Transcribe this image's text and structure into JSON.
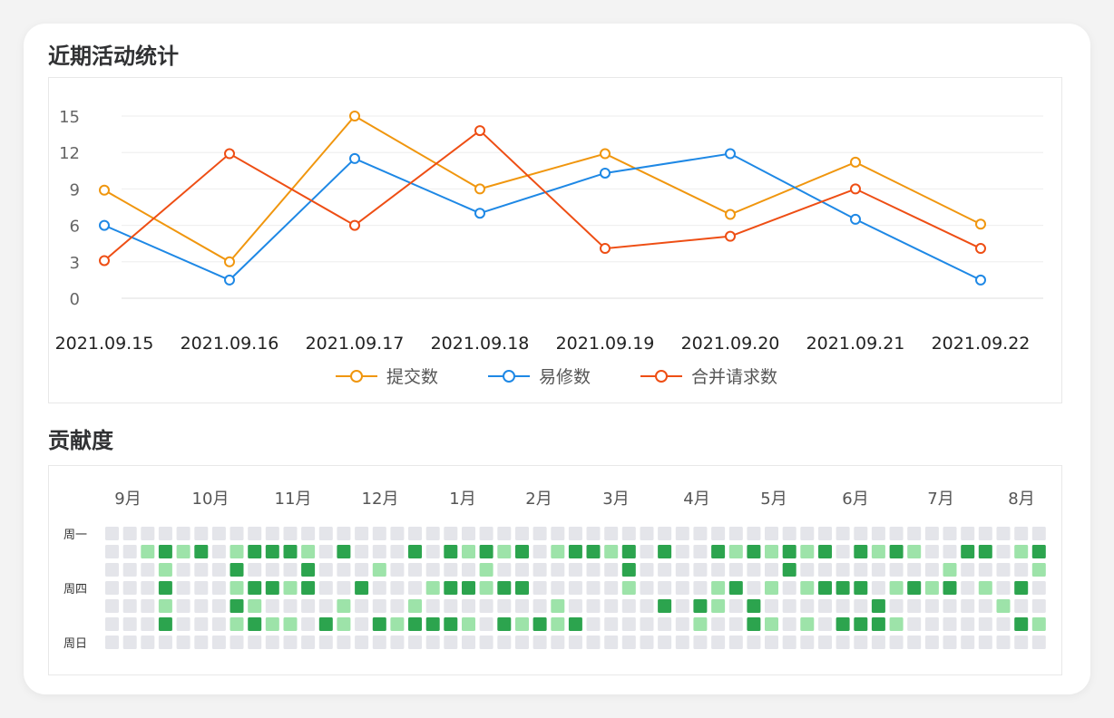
{
  "activity": {
    "title": "近期活动统计",
    "chart_data": {
      "type": "line",
      "categories": [
        "2021.09.15",
        "2021.09.16",
        "2021.09.17",
        "2021.09.18",
        "2021.09.19",
        "2021.09.20",
        "2021.09.21",
        "2021.09.22"
      ],
      "y_ticks": [
        0,
        3,
        6,
        9,
        12,
        15
      ],
      "ylim": [
        0,
        15
      ],
      "grid": true,
      "legend_position": "bottom-center",
      "series": [
        {
          "name": "提交数",
          "color": "#f0960e",
          "values": [
            8.9,
            3.0,
            15.0,
            9.0,
            11.9,
            6.9,
            11.2,
            6.1
          ]
        },
        {
          "name": "易修数",
          "color": "#1e88e5",
          "values": [
            6.0,
            1.5,
            11.5,
            7.0,
            10.3,
            11.9,
            6.5,
            1.5
          ]
        },
        {
          "name": "合并请求数",
          "color": "#ee4e14",
          "values": [
            3.1,
            11.9,
            6.0,
            13.8,
            4.1,
            5.1,
            9.0,
            4.1
          ]
        }
      ]
    }
  },
  "contribution": {
    "title": "贡献度",
    "months": [
      "9月",
      "10月",
      "11月",
      "12月",
      "1月",
      "2月",
      "3月",
      "4月",
      "5月",
      "6月",
      "7月",
      "8月"
    ],
    "day_labels": [
      "周一",
      "周四",
      "周日"
    ],
    "colors": {
      "empty": "#e4e5ea",
      "light": "#9de3a9",
      "dark": "#2ca44e"
    },
    "cells": [
      "E0000000000000000000000000000000000000000000000000000",
      "0ELDLD0LDDDL0D000D0DLDLD0LDDLD0D00DLDLDLD0DLDL00DD0LDL",
      "000L000D000D000L00000L0000000D00000000D00000000L0000L0D0",
      "000D000LDDLD00D000LDDLDD00000L0000LD0L0LDDD0LDLD0L0D0L0LDL",
      "000L000DL0000L000L0000000L00000D0DL0D000000D000000L00L0D0",
      "000D000LDLL0DL0DLDDDL0DLDLD000000L00DL0L0DDDL000000DL0000L0",
      "0000000000000000000000000000000000000000000000000000000"
    ]
  }
}
